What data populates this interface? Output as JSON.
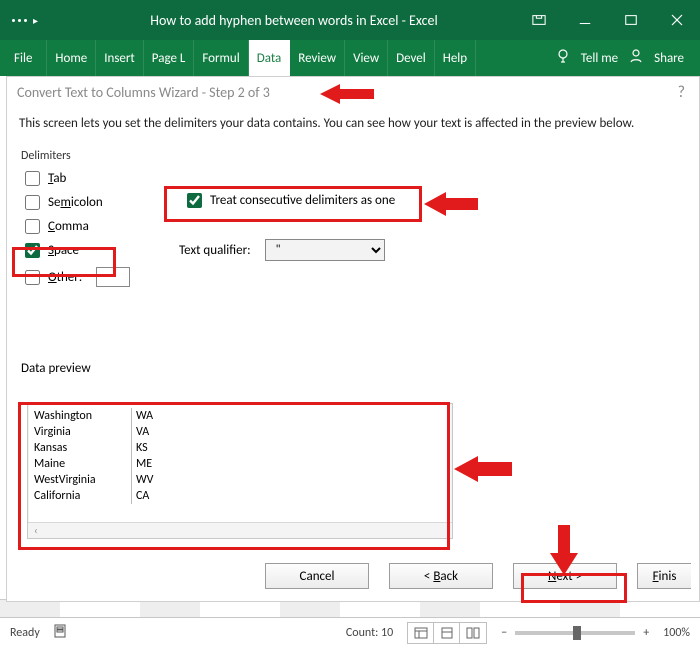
{
  "titlebar": {
    "title": "How to add hyphen between words in Excel  -  Excel"
  },
  "ribbon": {
    "tabs": [
      "File",
      "Home",
      "Insert",
      "Page L",
      "Formul",
      "Data",
      "Review",
      "View",
      "Devel",
      "Help"
    ],
    "active_index": 5,
    "tell_me": "Tell me",
    "share": "Share"
  },
  "dialog": {
    "title": "Convert Text to Columns Wizard - Step 2 of 3",
    "help": "?",
    "instruction": "This screen lets you set the delimiters your data contains.  You can see how your text is affected in the preview below.",
    "delimiters": {
      "legend": "Delimiters",
      "tab": {
        "label": "Tab",
        "checked": false
      },
      "semicolon": {
        "label": "Semicolon",
        "checked": false
      },
      "comma": {
        "label": "Comma",
        "checked": false
      },
      "space": {
        "label": "Space",
        "checked": true
      },
      "other": {
        "label": "Other:",
        "checked": false,
        "value": ""
      }
    },
    "consecutive": {
      "label": "Treat consecutive delimiters as one",
      "checked": true
    },
    "text_qualifier": {
      "label": "Text qualifier:",
      "value": "\""
    },
    "preview": {
      "label": "Data preview",
      "columns": [
        [
          "Washington",
          "Virginia",
          "Kansas",
          "Maine",
          "WestVirginia",
          "California"
        ],
        [
          "WA",
          "VA",
          "KS",
          "ME",
          "WV",
          "CA"
        ]
      ],
      "scroll_hint": "‹"
    },
    "buttons": {
      "cancel": "Cancel",
      "back": "< Back",
      "next": "Next >",
      "finish": "Finis"
    }
  },
  "statusbar": {
    "ready": "Ready",
    "count_label": "Count: 10",
    "zoom_label": "100%"
  }
}
